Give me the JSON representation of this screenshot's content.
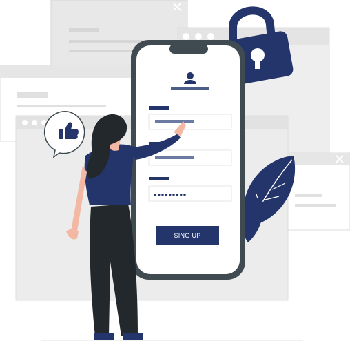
{
  "signup": {
    "label": "SING UP"
  },
  "password_mask": "●●●●●●●●●",
  "colors": {
    "navy": "#24356b",
    "phone_frame": "#3f4a51",
    "window_gray": "#e8e8e8",
    "window_line": "#d8d8d8",
    "skin": "#f2b8a4",
    "hair": "#23282c",
    "pants": "#23282c"
  },
  "icons": [
    "user-icon",
    "lock-icon",
    "thumbs-up-icon",
    "close-icon",
    "leaf-icon"
  ]
}
